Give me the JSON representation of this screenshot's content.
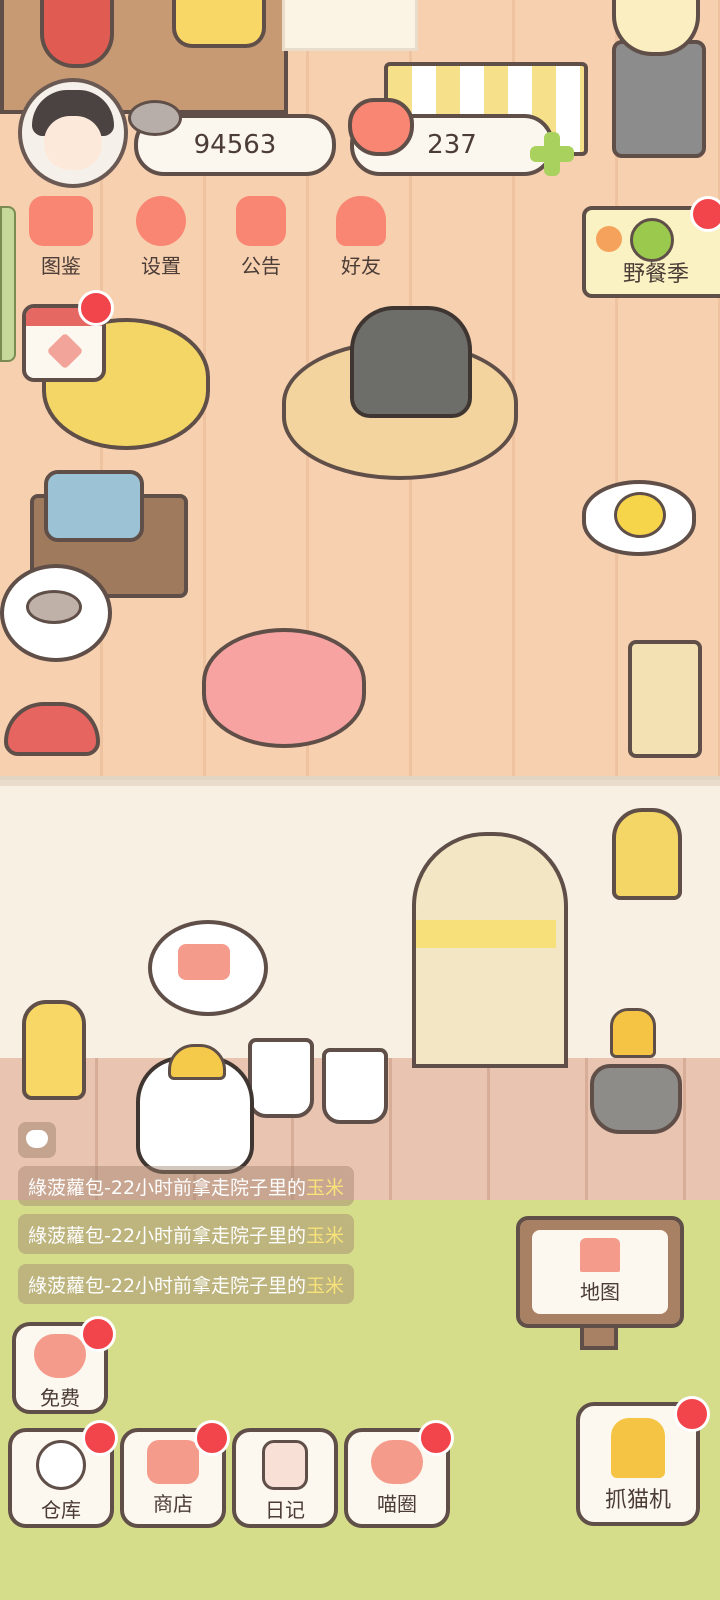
{
  "resources": {
    "fish": "94563",
    "hearts": "237"
  },
  "top_menu": [
    {
      "label": "图鉴"
    },
    {
      "label": "设置"
    },
    {
      "label": "公告"
    },
    {
      "label": "好友"
    }
  ],
  "event": {
    "label": "野餐季"
  },
  "activity_log": [
    {
      "prefix": "綠菠蘿包-22小时前拿走院子里的",
      "item": "玉米"
    },
    {
      "prefix": "綠菠蘿包-22小时前拿走院子里的",
      "item": "玉米"
    },
    {
      "prefix": "綠菠蘿包-22小时前拿走院子里的",
      "item": "玉米"
    }
  ],
  "free_button": {
    "label": "免费"
  },
  "bottom_nav": [
    {
      "label": "仓库"
    },
    {
      "label": "商店"
    },
    {
      "label": "日记"
    },
    {
      "label": "喵圈"
    }
  ],
  "map_button": {
    "label": "地图"
  },
  "claw_machine": {
    "label": "抓猫机"
  },
  "colors": {
    "notification": "#f2444b",
    "accent_orange": "#f98673",
    "outline": "#5f4f48",
    "highlight_text": "#f8e27a"
  }
}
